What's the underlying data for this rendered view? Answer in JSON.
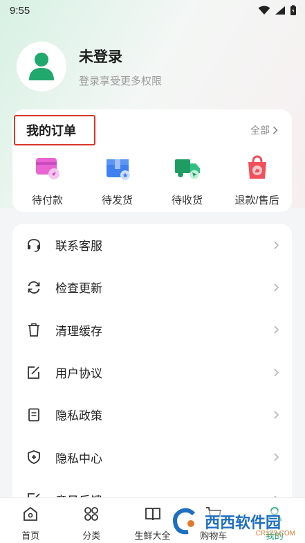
{
  "status_bar": {
    "time": "9:55"
  },
  "profile": {
    "title": "未登录",
    "subtitle": "登录享受更多权限"
  },
  "orders": {
    "title": "我的订单",
    "all_label": "全部",
    "items": [
      {
        "label": "待付款",
        "icon": "wallet-icon"
      },
      {
        "label": "待发货",
        "icon": "package-icon"
      },
      {
        "label": "待收货",
        "icon": "truck-icon"
      },
      {
        "label": "退款/售后",
        "icon": "refund-bag-icon"
      }
    ]
  },
  "menu": [
    {
      "label": "联系客服",
      "icon": "headset-icon"
    },
    {
      "label": "检查更新",
      "icon": "refresh-icon"
    },
    {
      "label": "清理缓存",
      "icon": "trash-icon"
    },
    {
      "label": "用户协议",
      "icon": "edit-doc-icon"
    },
    {
      "label": "隐私政策",
      "icon": "document-icon"
    },
    {
      "label": "隐私中心",
      "icon": "shield-plus-icon"
    },
    {
      "label": "意见反馈",
      "icon": "feedback-icon"
    }
  ],
  "tabs": [
    {
      "label": "首页",
      "icon": "home-icon"
    },
    {
      "label": "分类",
      "icon": "category-icon"
    },
    {
      "label": "生鲜大全",
      "icon": "book-icon"
    },
    {
      "label": "购物车",
      "icon": "cart-icon"
    },
    {
      "label": "我的",
      "icon": "user-icon",
      "active": true
    }
  ],
  "watermark": {
    "text": "西西软件园",
    "url": "CR173.COM"
  },
  "colors": {
    "accent": "#1fa56e",
    "highlight_border": "#d9362b"
  }
}
